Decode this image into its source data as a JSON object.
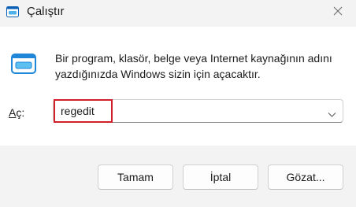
{
  "window": {
    "title": "Çalıştır",
    "app_icon": "run-dialog-icon",
    "close_icon": "close-icon"
  },
  "description": "Bir program, klasör, belge veya Internet kaynağının adını yazdığınızda Windows sizin için açacaktır.",
  "open_field": {
    "label_accel": "A",
    "label_rest": "ç:",
    "value": "regedit",
    "dropdown_icon": "chevron-down-icon",
    "highlight_color": "#d2202b"
  },
  "buttons": {
    "ok": "Tamam",
    "cancel": "İptal",
    "browse": "Gözat..."
  }
}
